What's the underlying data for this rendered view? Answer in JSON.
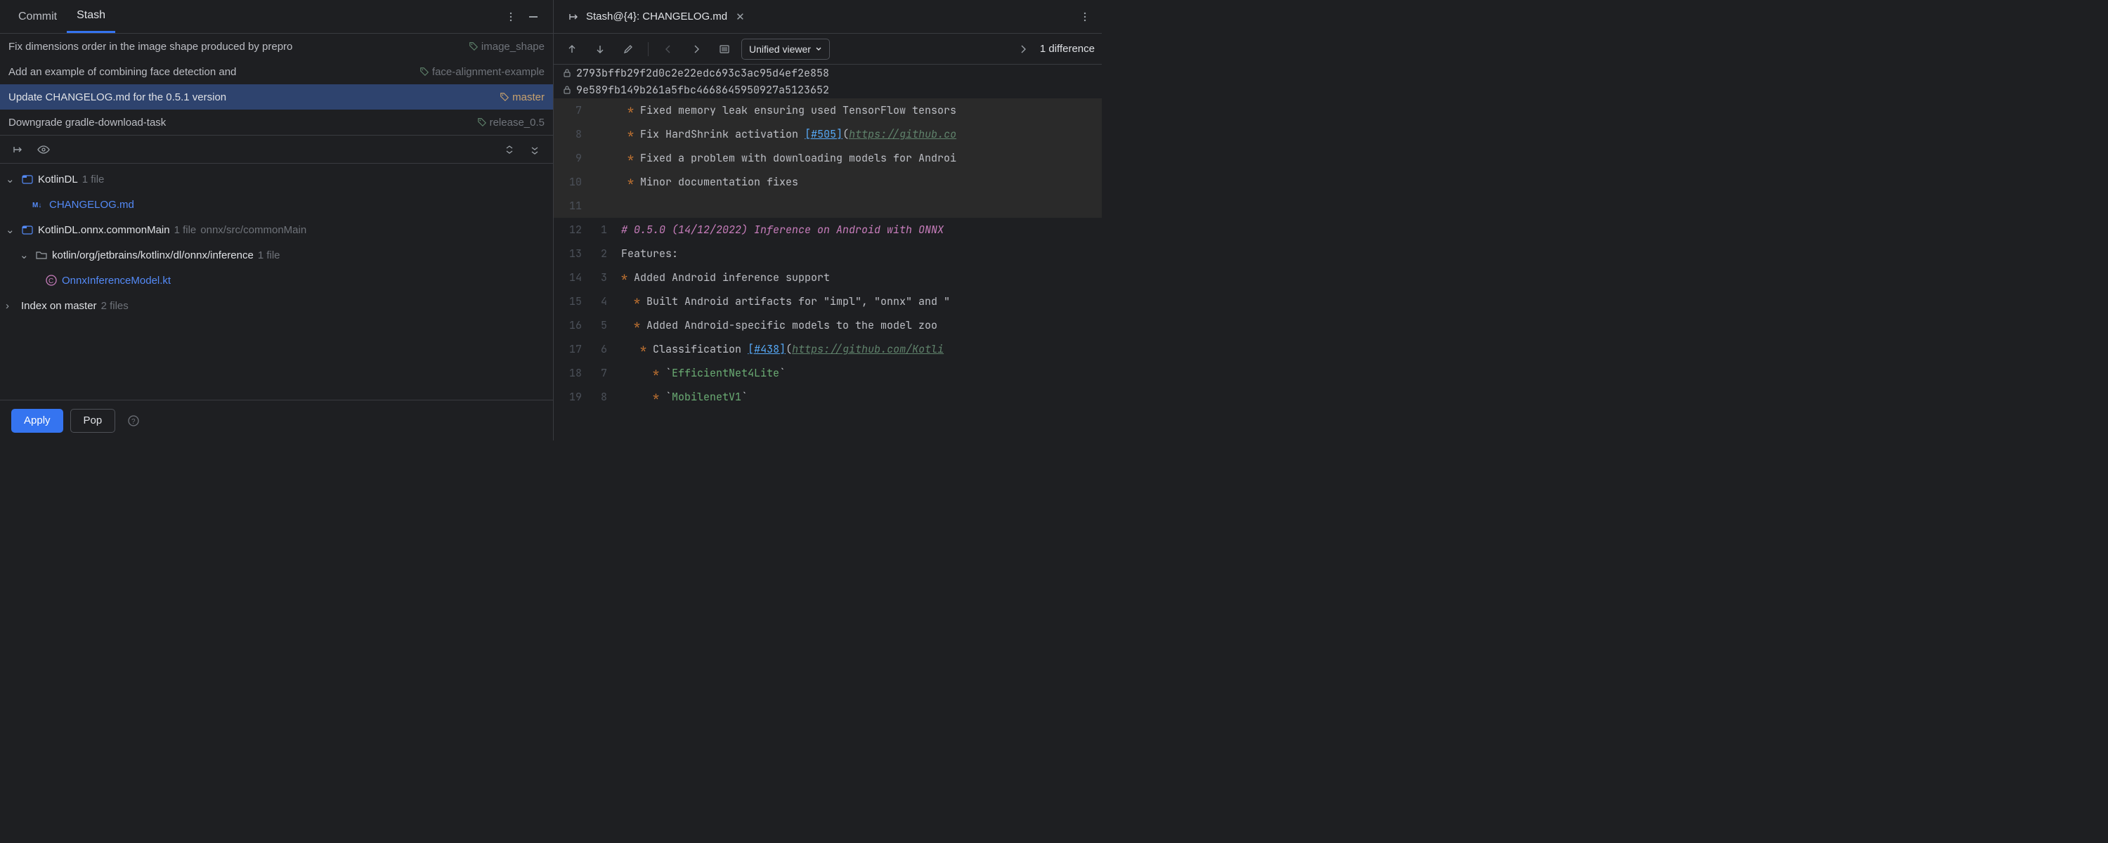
{
  "tabs": {
    "commit": "Commit",
    "stash": "Stash"
  },
  "commits": [
    {
      "msg": "Fix dimensions order in the image shape produced by prepro",
      "tag": "image_shape",
      "tagClass": ""
    },
    {
      "msg": "Add an example of combining face detection and ",
      "tag": "face-alignment-example",
      "tagClass": ""
    },
    {
      "msg": "Update CHANGELOG.md for the 0.5.1 version",
      "tag": "master",
      "tagClass": "master",
      "sel": true
    },
    {
      "msg": "Downgrade gradle-download-task",
      "tag": "release_0.5",
      "tagClass": ""
    }
  ],
  "tree": {
    "n0": {
      "label": "KotlinDL",
      "meta": "1 file"
    },
    "n0f": {
      "label": "CHANGELOG.md"
    },
    "n1": {
      "label": "KotlinDL.onnx.commonMain",
      "meta": "1 file",
      "path": "onnx/src/commonMain"
    },
    "n1a": {
      "label": "kotlin/org/jetbrains/kotlinx/dl/onnx/inference",
      "meta": "1 file"
    },
    "n1f": {
      "label": "OnnxInferenceModel.kt"
    },
    "n2": {
      "label": "Index on master",
      "meta": "2 files"
    }
  },
  "buttons": {
    "apply": "Apply",
    "pop": "Pop"
  },
  "editor": {
    "tab_title": "Stash@{4}: CHANGELOG.md",
    "viewer": "Unified viewer",
    "diff_count": "1 difference",
    "hash1": "2793bffb29f2d0c2e22edc693c3ac95d4ef2e858",
    "hash2": "9e589fb149b261a5fbc4668645950927a5123652"
  },
  "code": {
    "r7": "Fixed memory leak ensuring used TensorFlow tensors",
    "r8a": "Fix HardShrink activation ",
    "r8b": "[#505]",
    "r8c": "https://github.co",
    "r9": "Fixed a problem with downloading models for Androi",
    "r10": "Minor documentation fixes",
    "r12": "# 0.5.0 (14/12/2022) Inference on Android with ONNX",
    "r13": "Features:",
    "r14": "Added Android inference support",
    "r15": "Built Android artifacts for \"impl\", \"onnx\" and \"",
    "r16": "Added Android-specific models to the model zoo",
    "r17a": "Classification ",
    "r17b": "[#438]",
    "r17c": "https://github.com/Kotli",
    "r18": "EfficientNet4Lite",
    "r19": "MobilenetV1"
  },
  "gutter": {
    "g7": "7",
    "g8": "8",
    "g9": "9",
    "g10": "10",
    "g11": "11",
    "a12": "12",
    "b12": "1",
    "a13": "13",
    "b13": "2",
    "a14": "14",
    "b14": "3",
    "a15": "15",
    "b15": "4",
    "a16": "16",
    "b16": "5",
    "a17": "17",
    "b17": "6",
    "a18": "18",
    "b18": "7",
    "a19": "19",
    "b19": "8"
  }
}
